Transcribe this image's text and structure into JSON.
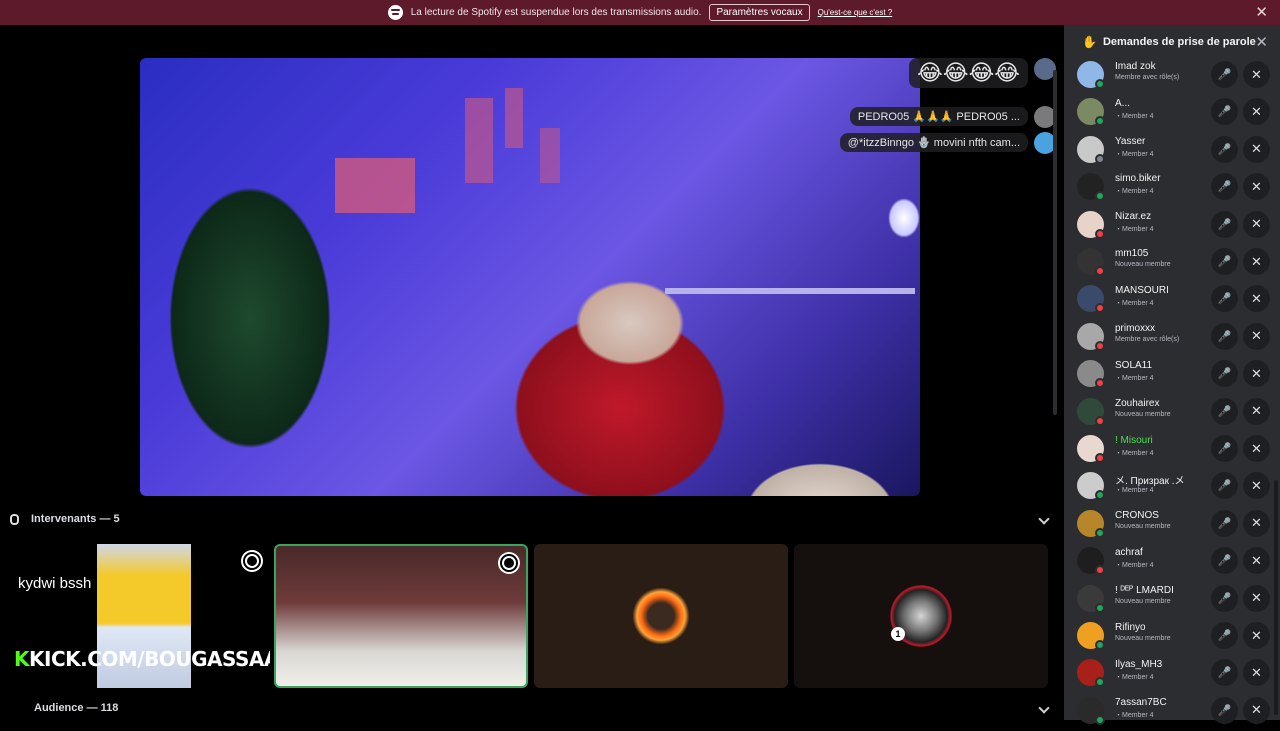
{
  "notice": {
    "text": "La lecture de Spotify est suspendue lors des transmissions audio.",
    "button": "Paramètres vocaux",
    "link": "Qu'est-ce que c'est ?",
    "close": "✕"
  },
  "chat": [
    {
      "text": "😂😂😂😂"
    },
    {
      "text": "PEDRO05 🙏🙏🙏 PEDRO05 ..."
    },
    {
      "text": "@*itzzBinngo 🪬 movini nfth cam..."
    }
  ],
  "speakers": {
    "header": "Intervenants — 5",
    "tile1_name": "kydwi bssh",
    "tile1_kick_k": "K",
    "tile1_kick": "KICK.COM/BOUGASSAA",
    "mute_badge": "1"
  },
  "audience": {
    "header": "Audience — 118"
  },
  "sidebar": {
    "title": "Demandes de prise de parole",
    "close": "✕",
    "requests": [
      {
        "name": "Imad zok",
        "role": "Membre avec rôle(s)",
        "status": "on",
        "color": "#8fb7e8"
      },
      {
        "name": "A...",
        "role": "・Member 4",
        "status": "on",
        "color": "#7b8a62"
      },
      {
        "name": "Yasser",
        "role": "・Member 4",
        "status": "off",
        "color": "#c9c9c9"
      },
      {
        "name": "simo.biker",
        "role": "・Member 4",
        "status": "on",
        "color": "#222222"
      },
      {
        "name": "Nizar.ez",
        "role": "・Member 4",
        "status": "dnd",
        "color": "#e7d3c8"
      },
      {
        "name": "mm105",
        "role": "Nouveau membre",
        "status": "dnd",
        "color": "#333333"
      },
      {
        "name": "MANSOURI",
        "role": "・Member 4",
        "status": "dnd",
        "color": "#3a4a6a"
      },
      {
        "name": "primoxxx",
        "role": "Membre avec rôle(s)",
        "status": "dnd",
        "color": "#a8a8a8"
      },
      {
        "name": "SOLA11",
        "role": "・Member 4",
        "status": "dnd",
        "color": "#8a8a8a"
      },
      {
        "name": "Zouhairex",
        "role": "Nouveau membre",
        "status": "dnd",
        "color": "#2f4a3a"
      },
      {
        "name": "! Misouri",
        "role": "・Member 4",
        "status": "dnd",
        "color": "#e8d8d0",
        "green": true
      },
      {
        "name": "メ. Призрак .メ",
        "role": "・Member 4",
        "status": "on",
        "color": "#cccccc"
      },
      {
        "name": "CRONOS",
        "role": "Nouveau membre",
        "status": "on",
        "color": "#b8862a"
      },
      {
        "name": "achraf",
        "role": "・Member 4",
        "status": "dnd",
        "color": "#1e1e1e"
      },
      {
        "name": "! ᴰᴱᴾ LMARDI",
        "role": "Nouveau membre",
        "status": "on",
        "color": "#3a3a3a"
      },
      {
        "name": "Rifinyo",
        "role": "Nouveau membre",
        "status": "on",
        "color": "#f0a020"
      },
      {
        "name": "Ilyas_MH3",
        "role": "・Member 4",
        "status": "on",
        "color": "#a8201a"
      },
      {
        "name": "7assan7BC",
        "role": "・Member 4",
        "status": "on",
        "color": "#2a2a2a"
      }
    ]
  }
}
